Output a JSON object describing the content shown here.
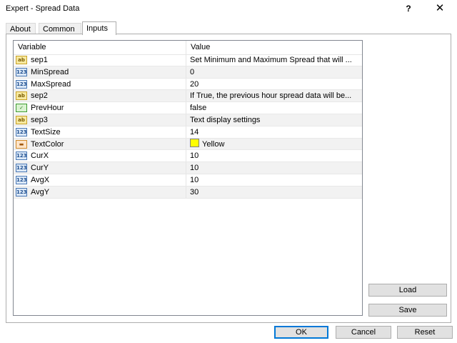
{
  "window": {
    "title": "Expert - Spread Data",
    "help_glyph": "?",
    "close_glyph": "✕"
  },
  "tabs": [
    {
      "label": "About",
      "active": false
    },
    {
      "label": "Common",
      "active": false
    },
    {
      "label": "Inputs",
      "active": true
    }
  ],
  "table": {
    "headers": {
      "variable": "Variable",
      "value": "Value"
    },
    "rows": [
      {
        "icon": "string-icon",
        "glyph": "ab",
        "variable": "sep1",
        "value": "Set Minimum and Maximum Spread that will ..."
      },
      {
        "icon": "number-icon",
        "glyph": "123",
        "variable": "MinSpread",
        "value": "0"
      },
      {
        "icon": "number-icon",
        "glyph": "123",
        "variable": "MaxSpread",
        "value": "20"
      },
      {
        "icon": "string-icon",
        "glyph": "ab",
        "variable": "sep2",
        "value": "If True, the previous hour spread data will be..."
      },
      {
        "icon": "bool-icon",
        "glyph": "✓",
        "variable": "PrevHour",
        "value": "false"
      },
      {
        "icon": "string-icon",
        "glyph": "ab",
        "variable": "sep3",
        "value": "Text display settings"
      },
      {
        "icon": "number-icon",
        "glyph": "123",
        "variable": "TextSize",
        "value": "14"
      },
      {
        "icon": "color-icon",
        "glyph": "▬",
        "variable": "TextColor",
        "value": "Yellow",
        "swatch": "#ffff00"
      },
      {
        "icon": "number-icon",
        "glyph": "123",
        "variable": "CurX",
        "value": "10"
      },
      {
        "icon": "number-icon",
        "glyph": "123",
        "variable": "CurY",
        "value": "10"
      },
      {
        "icon": "number-icon",
        "glyph": "123",
        "variable": "AvgX",
        "value": "10"
      },
      {
        "icon": "number-icon",
        "glyph": "123",
        "variable": "AvgY",
        "value": "30"
      }
    ]
  },
  "buttons": {
    "load": "Load",
    "save": "Save",
    "ok": "OK",
    "cancel": "Cancel",
    "reset": "Reset"
  }
}
